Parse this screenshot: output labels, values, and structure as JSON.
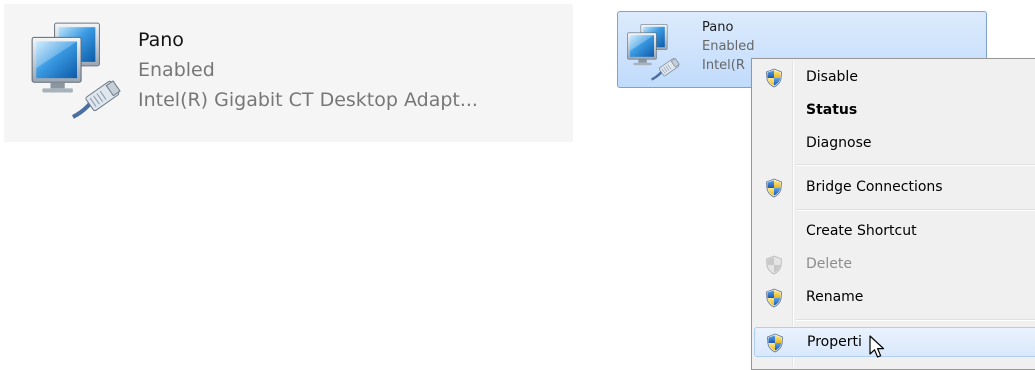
{
  "left_panel": {
    "name": "Pano",
    "status": "Enabled",
    "device": "Intel(R) Gigabit CT Desktop Adapt...",
    "icon": "network-adapter-icon"
  },
  "selected_tile": {
    "name": "Pano",
    "status": "Enabled",
    "device": "Intel(R",
    "icon": "network-adapter-icon"
  },
  "context_menu": {
    "items": [
      {
        "label": "Disable",
        "icon": "uac-shield-icon",
        "bold": false,
        "enabled": true
      },
      {
        "label": "Status",
        "icon": "",
        "bold": true,
        "enabled": true
      },
      {
        "label": "Diagnose",
        "icon": "",
        "bold": false,
        "enabled": true
      },
      {
        "label": "Bridge Connections",
        "icon": "uac-shield-icon",
        "bold": false,
        "enabled": true
      },
      {
        "label": "Create Shortcut",
        "icon": "",
        "bold": false,
        "enabled": true
      },
      {
        "label": "Delete",
        "icon": "uac-shield-icon",
        "bold": false,
        "enabled": false
      },
      {
        "label": "Rename",
        "icon": "uac-shield-icon",
        "bold": false,
        "enabled": true
      },
      {
        "label": "Properti",
        "icon": "uac-shield-icon",
        "bold": false,
        "enabled": true,
        "hovered": true
      }
    ]
  },
  "colors": {
    "selection_border": "#7da2ce",
    "selection_fill": "#c1dbfc",
    "menu_background": "#f0f0f0",
    "disabled_text": "#8d8d8d"
  }
}
